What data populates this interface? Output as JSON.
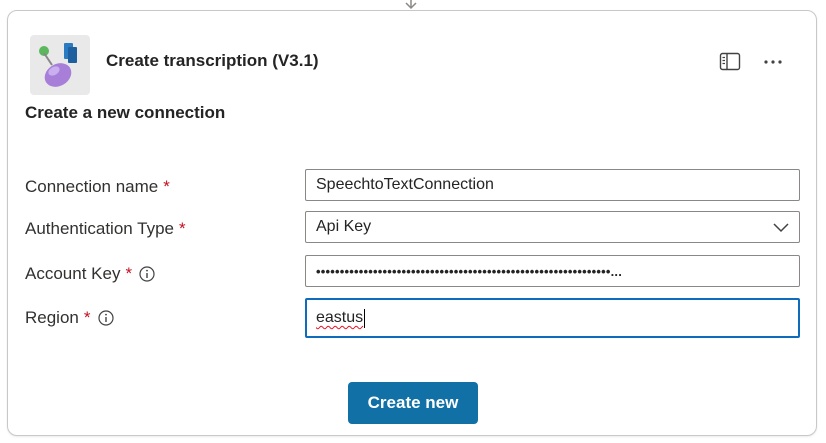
{
  "header": {
    "title": "Create transcription (V3.1)",
    "logo_icon": "speech-to-text-logo-icon",
    "panel_icon": "side-panel-icon",
    "more_icon": "more-options-icon"
  },
  "section": {
    "title": "Create a new connection"
  },
  "form": {
    "required_marker": "*",
    "connection_name": {
      "label": "Connection name",
      "value": "SpeechtoTextConnection"
    },
    "authentication_type": {
      "label": "Authentication Type",
      "value": "Api Key"
    },
    "account_key": {
      "label": "Account Key",
      "value": "••••••••••••••••••••••••••••••••••••••••••••••••••••••••••••••..."
    },
    "region": {
      "label": "Region",
      "value": "eastus"
    }
  },
  "actions": {
    "create_label": "Create new"
  },
  "colors": {
    "accent": "#1170a5",
    "required": "#c50f1f",
    "focus_border": "#0f6cbd"
  }
}
